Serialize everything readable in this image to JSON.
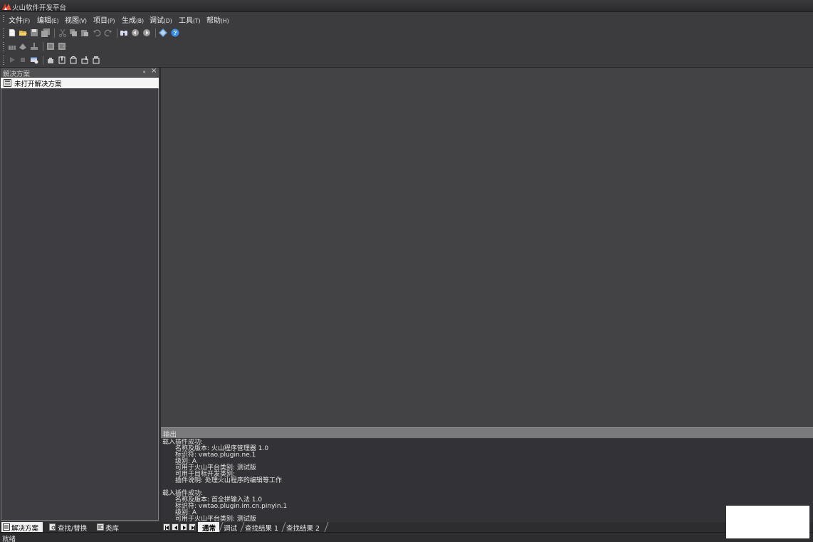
{
  "window": {
    "title": "火山软件开发平台"
  },
  "menu": [
    {
      "label": "文件",
      "accel": "(F)"
    },
    {
      "label": "编辑",
      "accel": "(E)"
    },
    {
      "label": "视图",
      "accel": "(V)"
    },
    {
      "label": "项目",
      "accel": "(P)"
    },
    {
      "label": "生成",
      "accel": "(B)"
    },
    {
      "label": "调试",
      "accel": "(D)"
    },
    {
      "label": "工具",
      "accel": "(T)"
    },
    {
      "label": "帮助",
      "accel": "(H)"
    }
  ],
  "toolbar_icons": {
    "row1": [
      "new-file-icon",
      "open-folder-icon",
      "save-icon",
      "save-all-icon",
      "cut-icon",
      "copy-icon",
      "paste-icon",
      "undo-icon",
      "redo-icon",
      "find-icon",
      "navigate-back-icon",
      "navigate-forward-icon",
      "plugin-icon",
      "help-icon"
    ],
    "row2": [
      "build-icon",
      "rebuild-icon",
      "clean-icon",
      "comment-icon",
      "uncomment-icon"
    ],
    "row3": [
      "run-icon",
      "stop-icon",
      "debug-window-icon",
      "breakpoint-icon",
      "step-into-icon",
      "step-over-icon",
      "step-out-icon",
      "run-to-cursor-icon"
    ]
  },
  "solution_panel": {
    "title": "解决方案",
    "pin": "ᵩ",
    "close": "×",
    "root_item": "未打开解决方案"
  },
  "left_tabs": [
    {
      "label": "解决方案",
      "active": true,
      "icon": "solution-icon"
    },
    {
      "label": "查找/替换",
      "active": false,
      "icon": "find-replace-icon"
    },
    {
      "label": "类库",
      "active": false,
      "icon": "library-icon"
    }
  ],
  "output_panel": {
    "title": "输出",
    "lines": [
      {
        "text": "载入插件成功:",
        "indent": false
      },
      {
        "text": "名称及版本: 火山程序管理器 1.0",
        "indent": true
      },
      {
        "text": "标识符: vwtao.plugin.ne.1",
        "indent": true
      },
      {
        "text": "级别: A",
        "indent": true
      },
      {
        "text": "可用于火山平台类别: 测试版",
        "indent": true
      },
      {
        "text": "可用于目标开发类别:",
        "indent": true
      },
      {
        "text": "插件说明: 处理火山程序的编辑等工作",
        "indent": true
      },
      {
        "text": "",
        "indent": false
      },
      {
        "text": "载入插件成功:",
        "indent": false
      },
      {
        "text": "名称及版本: 首全拼输入法 1.0",
        "indent": true
      },
      {
        "text": "标识符: vwtao.plugin.im.cn.pinyin.1",
        "indent": true
      },
      {
        "text": "级别: A",
        "indent": true
      },
      {
        "text": "可用于火山平台类别: 测试版",
        "indent": true
      }
    ]
  },
  "output_tabs": [
    {
      "label": "通常",
      "active": true
    },
    {
      "label": "调试",
      "active": false
    },
    {
      "label": "查找结果 1",
      "active": false
    },
    {
      "label": "查找结果 2",
      "active": false
    }
  ],
  "status": {
    "text": "就绪"
  }
}
